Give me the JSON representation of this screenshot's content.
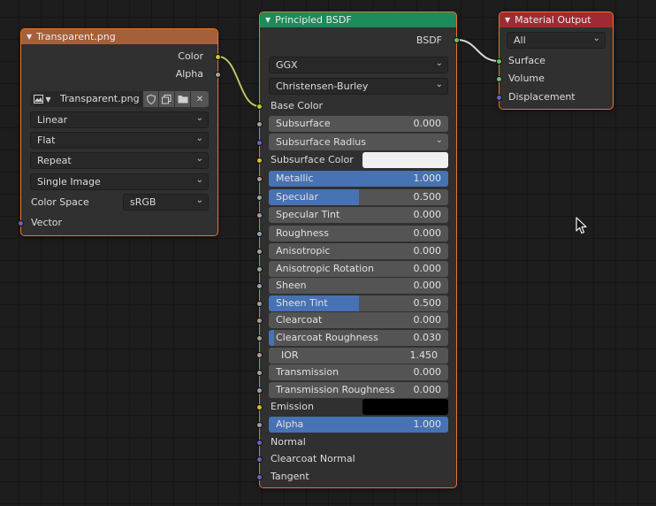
{
  "colors": {
    "image_header": "#a3603a",
    "bsdf_header": "#1c8a5a",
    "output_header": "#a02a33",
    "field_fill": "#4772b3",
    "selection_outline": "#ed7230"
  },
  "image_node": {
    "title": "Transparent.png",
    "outputs": {
      "color": "Color",
      "alpha": "Alpha"
    },
    "image_name": "Transparent.png",
    "interpolation": "Linear",
    "projection": "Flat",
    "extension": "Repeat",
    "source": "Single Image",
    "color_space_label": "Color Space",
    "color_space_value": "sRGB",
    "vector_input": "Vector"
  },
  "bsdf_node": {
    "title": "Principled BSDF",
    "output_label": "BSDF",
    "distribution": "GGX",
    "subsurface_method": "Christensen-Burley",
    "base_color_label": "Base Color",
    "subsurface": {
      "label": "Subsurface",
      "value": "0.000",
      "fill": 0.0
    },
    "subsurface_radius": "Subsurface Radius",
    "subsurface_color_label": "Subsurface Color",
    "subsurface_color": "#f0f0f0",
    "metallic": {
      "label": "Metallic",
      "value": "1.000",
      "fill": 1.0
    },
    "specular": {
      "label": "Specular",
      "value": "0.500",
      "fill": 0.5
    },
    "specular_tint": {
      "label": "Specular Tint",
      "value": "0.000",
      "fill": 0.0
    },
    "roughness": {
      "label": "Roughness",
      "value": "0.000",
      "fill": 0.0
    },
    "anisotropic": {
      "label": "Anisotropic",
      "value": "0.000",
      "fill": 0.0
    },
    "anisotropic_rotation": {
      "label": "Anisotropic Rotation",
      "value": "0.000",
      "fill": 0.0
    },
    "sheen": {
      "label": "Sheen",
      "value": "0.000",
      "fill": 0.0
    },
    "sheen_tint": {
      "label": "Sheen Tint",
      "value": "0.500",
      "fill": 0.5
    },
    "clearcoat": {
      "label": "Clearcoat",
      "value": "0.000",
      "fill": 0.0
    },
    "clearcoat_roughness": {
      "label": "Clearcoat Roughness",
      "value": "0.030",
      "fill": 0.03
    },
    "ior": {
      "label": "IOR",
      "value": "1.450"
    },
    "transmission": {
      "label": "Transmission",
      "value": "0.000",
      "fill": 0.0
    },
    "transmission_roughness": {
      "label": "Transmission Roughness",
      "value": "0.000",
      "fill": 0.0
    },
    "emission_label": "Emission",
    "emission_color": "#000000",
    "alpha": {
      "label": "Alpha",
      "value": "1.000",
      "fill": 1.0
    },
    "normal_label": "Normal",
    "clearcoat_normal_label": "Clearcoat Normal",
    "tangent_label": "Tangent"
  },
  "output_node": {
    "title": "Material Output",
    "target": "All",
    "inputs": {
      "surface": "Surface",
      "volume": "Volume",
      "displacement": "Displacement"
    }
  }
}
